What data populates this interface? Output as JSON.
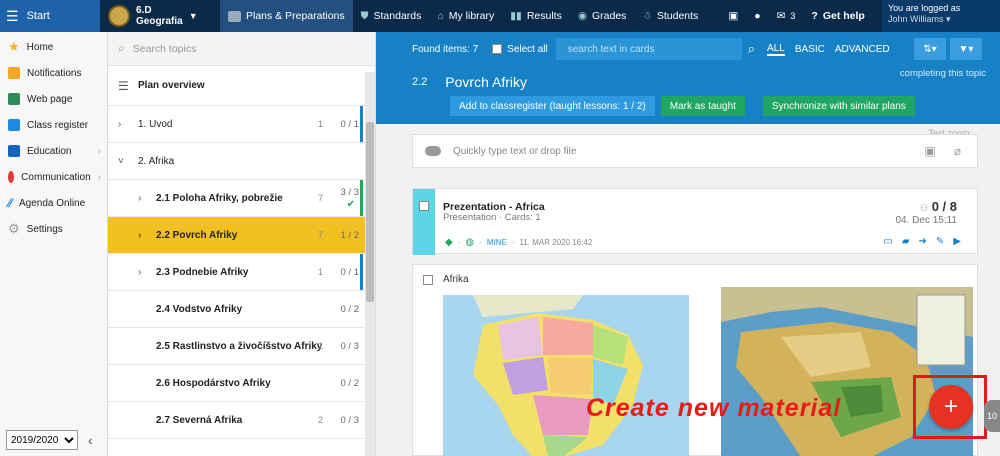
{
  "topbar": {
    "start": "Start",
    "class_code": "6.D",
    "class_subject": "Geografia",
    "items": [
      {
        "label": "Plans & Preparations",
        "icon": "plans-icon"
      },
      {
        "label": "Standards",
        "icon": "shield-icon"
      },
      {
        "label": "My library",
        "icon": "library-icon"
      },
      {
        "label": "Results",
        "icon": "results-icon"
      },
      {
        "label": "Grades",
        "icon": "grades-icon"
      },
      {
        "label": "Students",
        "icon": "students-icon"
      }
    ],
    "messages_count": "3",
    "help": "Get help",
    "logged_as": "You are logged as",
    "user": "John Williams"
  },
  "sidebar": {
    "items": [
      {
        "label": "Home",
        "icon": "star-icon",
        "color": "#f0b429"
      },
      {
        "label": "Notifications",
        "icon": "mail-icon",
        "color": "#f5a623"
      },
      {
        "label": "Web page",
        "icon": "house-icon",
        "color": "#2e8b57"
      },
      {
        "label": "Class register",
        "icon": "register-icon",
        "color": "#1e88e5"
      },
      {
        "label": "Education",
        "icon": "education-icon",
        "color": "#1565c0"
      },
      {
        "label": "Communication",
        "icon": "chat-icon",
        "color": "#e53935"
      },
      {
        "label": "Agenda Online",
        "icon": "agenda-icon",
        "color": "#1e88e5"
      },
      {
        "label": "Settings",
        "icon": "gear-icon",
        "color": "#999999"
      }
    ],
    "year": "2019/2020"
  },
  "topics": {
    "search_placeholder": "Search topics",
    "overview": "Plan overview",
    "rows": [
      {
        "chev": "›",
        "label": "1. Uvod",
        "count": "1",
        "frac": "0 / 1",
        "level": 0,
        "bar": "#1681c4"
      },
      {
        "chev": "˅",
        "label": "2. Afrika",
        "count": "",
        "frac": "",
        "level": 0,
        "bar": ""
      },
      {
        "chev": "›",
        "label": "2.1 Poloha Afriky, pobrežie",
        "count": "7",
        "frac": "3 / 3",
        "level": 1,
        "bar": "#1fa661",
        "check": "✔"
      },
      {
        "chev": "›",
        "label": "2.2 Povrch Afriky",
        "count": "7",
        "frac": "1 / 2",
        "level": 1,
        "bar": "",
        "selected": true
      },
      {
        "chev": "›",
        "label": "2.3 Podnebie Afriky",
        "count": "1",
        "frac": "0 / 1",
        "level": 1,
        "bar": "#1681c4"
      },
      {
        "chev": "",
        "label": "2.4 Vodstvo Afriky",
        "count": "",
        "frac": "0 / 2",
        "level": 1,
        "bar": ""
      },
      {
        "chev": "",
        "label": "2.5 Rastlinstvo a živočíšstvo Afriky",
        "count": "1",
        "frac": "0 / 3",
        "level": 1,
        "bar": ""
      },
      {
        "chev": "",
        "label": "2.6 Hospodárstvo Afriky",
        "count": "",
        "frac": "0 / 2",
        "level": 1,
        "bar": ""
      },
      {
        "chev": "",
        "label": "2.7 Severná Afrika",
        "count": "2",
        "frac": "0 / 3",
        "level": 1,
        "bar": ""
      }
    ]
  },
  "main": {
    "found": "Found items: 7",
    "select_all": "Select all",
    "search_placeholder": "search text in cards",
    "tabs": [
      "ALL",
      "BASIC",
      "ADVANCED"
    ],
    "topic_number": "2.2",
    "topic_title": "Povrch Afriky",
    "topic_note": "completing this topic",
    "add_btn": "Add to classregister (taught lessons: 1 / 2)",
    "mark_btn": "Mark as taught",
    "sync_btn": "Synchronize with similar plans",
    "zoom_label": "Text zoom:",
    "drop_placeholder": "Quickly type text or drop file",
    "card1": {
      "title": "Prezentation - Africa",
      "subtitle": "Presentation · Cards: 1",
      "score": "0 / 8",
      "date": "04. Dec 15:11",
      "mine": "MINE",
      "meta_date": "11. MAR 2020 16:42"
    },
    "card2": {
      "title": "Afrika"
    }
  },
  "overlay_text": "Create new material",
  "fab_label": "+",
  "side_bubble": "10"
}
